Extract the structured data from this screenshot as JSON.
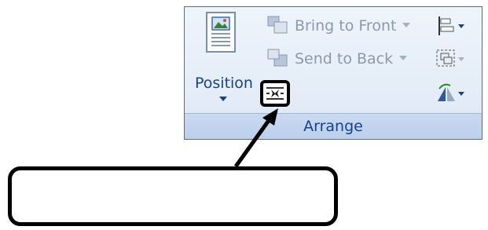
{
  "ribbon": {
    "group_label": "Arrange",
    "position_label": "Position",
    "bring_to_front_label": "Bring to Front",
    "send_to_back_label": "Send to Back"
  },
  "callout": {
    "text": ""
  },
  "icons": {
    "position": "position-icon",
    "bring_to_front": "bring-to-front-icon",
    "send_to_back": "send-to-back-icon",
    "text_wrapping": "text-wrapping-icon",
    "align": "align-icon",
    "group": "group-icon",
    "rotate": "rotate-icon"
  },
  "colors": {
    "label_blue": "#15428b",
    "disabled_gray": "#8a99ad",
    "highlight_border": "#000000"
  }
}
